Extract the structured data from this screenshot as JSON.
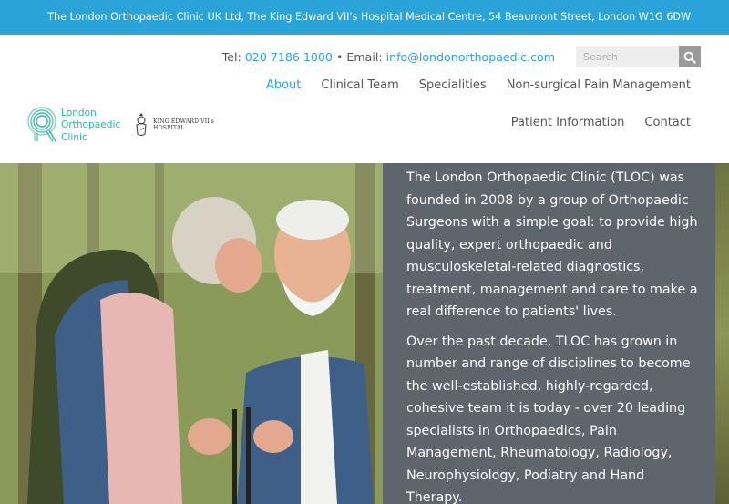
{
  "topbar": {
    "address": "The London Orthopaedic Clinic UK Ltd, The King Edward VII's Hospital Medical Centre, 54 Beaumont Street, London W1G 6DW"
  },
  "contact": {
    "tel_label": "Tel:",
    "tel_value": "020 7186 1000",
    "separator": "•",
    "email_label": "Email:",
    "email_value": "info@londonorthopaedic.com"
  },
  "search": {
    "placeholder": "Search",
    "icon": "search-icon"
  },
  "brand": {
    "logo_text": "London\nOrthopaedic\nClinic",
    "partner_text": "KING EDWARD VII's\nHOSPITAL",
    "accent": "#2fb5a8"
  },
  "nav": {
    "primary": [
      "About",
      "Clinical Team",
      "Specialities",
      "Non-surgical Pain Management"
    ],
    "secondary": [
      "Patient Information",
      "Contact"
    ],
    "active": "About"
  },
  "hero": {
    "paragraphs": [
      "The London Orthopaedic Clinic (TLOC) was founded in 2008 by a group of Orthopaedic Surgeons with a simple goal: to provide high quality, expert orthopaedic and musculoskeletal-related diagnostics, treatment, management and care to make a real difference to patients' lives.",
      "Over the past decade, TLOC has grown in number and range of disciplines to become the well-established, highly-regarded, cohesive team it is today - over 20 leading specialists in Orthopaedics, Pain Management, Rheumatology, Radiology, Neurophysiology, Podiatry and Hand Therapy."
    ]
  },
  "colors": {
    "topbar": "#2aa4d8",
    "link": "#2aa4d8",
    "panel": "#5f656d"
  }
}
